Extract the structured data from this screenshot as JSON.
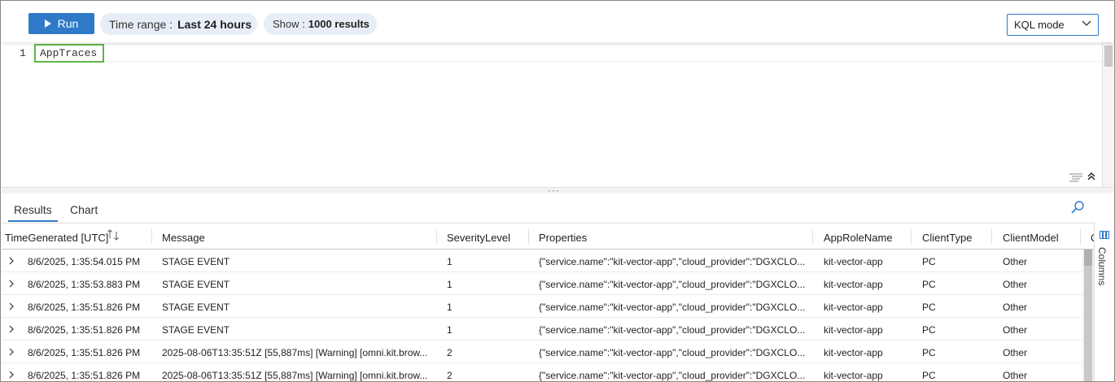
{
  "toolbar": {
    "run_label": "Run",
    "time_range_label": "Time range :",
    "time_range_value": "Last 24 hours",
    "show_label": "Show :",
    "show_value": "1000 results",
    "mode_label": "KQL mode"
  },
  "editor": {
    "line_number": "1",
    "query": "AppTraces"
  },
  "tabs": [
    "Results",
    "Chart"
  ],
  "columns": [
    "TimeGenerated [UTC]",
    "Message",
    "SeverityLevel",
    "Properties",
    "AppRoleName",
    "ClientType",
    "ClientModel",
    "C"
  ],
  "rows": [
    [
      "8/6/2025, 1:35:54.015 PM",
      "STAGE EVENT",
      "1",
      "{\"service.name\":\"kit-vector-app\",\"cloud_provider\":\"DGXCLO...",
      "kit-vector-app",
      "PC",
      "Other"
    ],
    [
      "8/6/2025, 1:35:53.883 PM",
      "STAGE EVENT",
      "1",
      "{\"service.name\":\"kit-vector-app\",\"cloud_provider\":\"DGXCLO...",
      "kit-vector-app",
      "PC",
      "Other"
    ],
    [
      "8/6/2025, 1:35:51.826 PM",
      "STAGE EVENT",
      "1",
      "{\"service.name\":\"kit-vector-app\",\"cloud_provider\":\"DGXCLO...",
      "kit-vector-app",
      "PC",
      "Other"
    ],
    [
      "8/6/2025, 1:35:51.826 PM",
      "STAGE EVENT",
      "1",
      "{\"service.name\":\"kit-vector-app\",\"cloud_provider\":\"DGXCLO...",
      "kit-vector-app",
      "PC",
      "Other"
    ],
    [
      "8/6/2025, 1:35:51.826 PM",
      "2025-08-06T13:35:51Z [55,887ms] [Warning] [omni.kit.brow...",
      "2",
      "{\"service.name\":\"kit-vector-app\",\"cloud_provider\":\"DGXCLO...",
      "kit-vector-app",
      "PC",
      "Other"
    ],
    [
      "8/6/2025, 1:35:51.826 PM",
      "2025-08-06T13:35:51Z [55,887ms] [Warning] [omni.kit.brow...",
      "2",
      "{\"service.name\":\"kit-vector-app\",\"cloud_provider\":\"DGXCLO...",
      "kit-vector-app",
      "PC",
      "Other"
    ]
  ],
  "side_panel": {
    "columns_label": "Columns"
  },
  "icons": {
    "run": "play-icon",
    "dropdown": "chevron-down-icon",
    "search": "search-icon",
    "sort": "sort-icon",
    "expand": "chevron-right-icon",
    "columns": "columns-icon",
    "format": "format-query-icon",
    "collapse": "collapse-up-icon"
  },
  "colors": {
    "accent": "#2f79c8",
    "pill_bg": "#e8eef7",
    "highlight_box": "#5db544"
  }
}
